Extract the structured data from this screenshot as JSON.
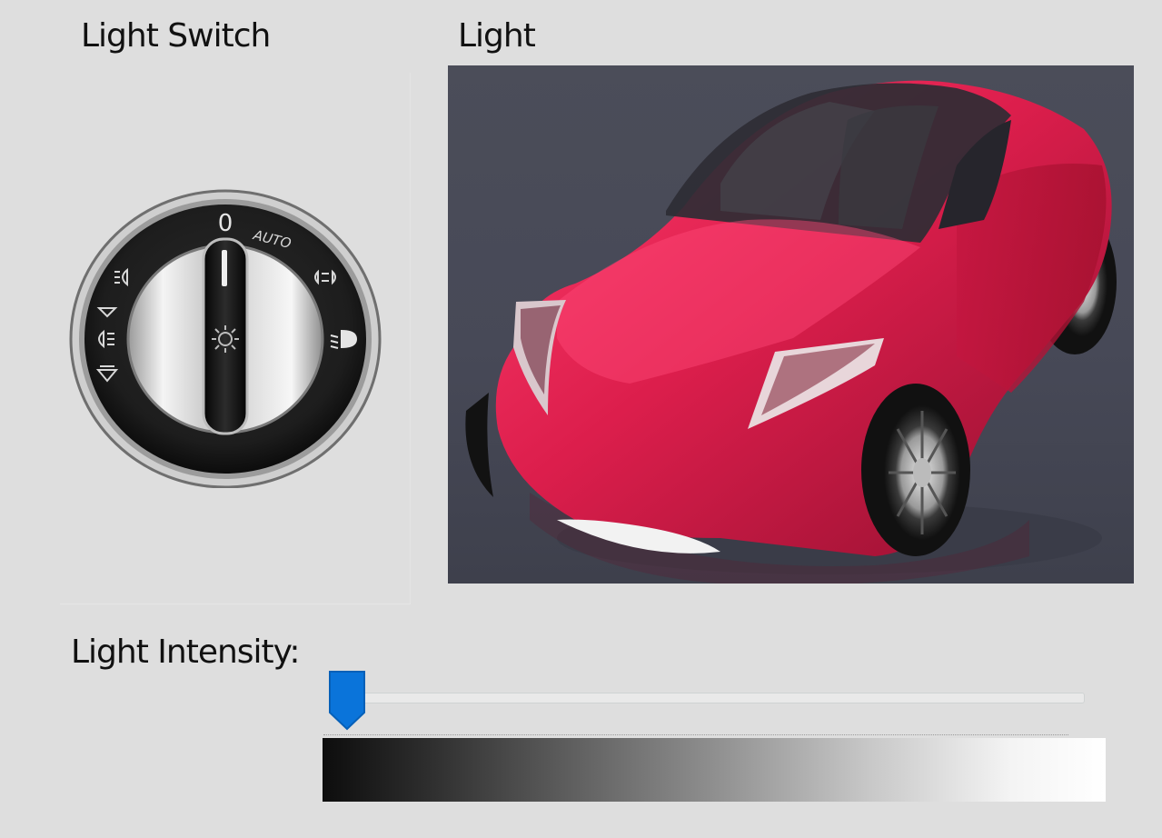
{
  "labels": {
    "light_switch": "Light Switch",
    "light": "Light",
    "light_intensity": "Light Intensity:"
  },
  "dial": {
    "markings": {
      "top": "0",
      "auto": "AUTO"
    },
    "selected_position": "0"
  },
  "slider": {
    "value_fraction": 0.0
  },
  "colors": {
    "window_background": "#dedede",
    "slider_thumb": "#0a74da",
    "car_body": "#d81f4a",
    "scene_background": "#484a56"
  },
  "icons": {
    "dial_left": [
      "fog-light-front-icon",
      "parking-light-icon",
      "fog-lamp-icon",
      "rear-fog-icon"
    ],
    "dial_right": [
      "parking-lights-icon",
      "low-beam-icon"
    ],
    "dial_center": "instrument-light-icon"
  }
}
